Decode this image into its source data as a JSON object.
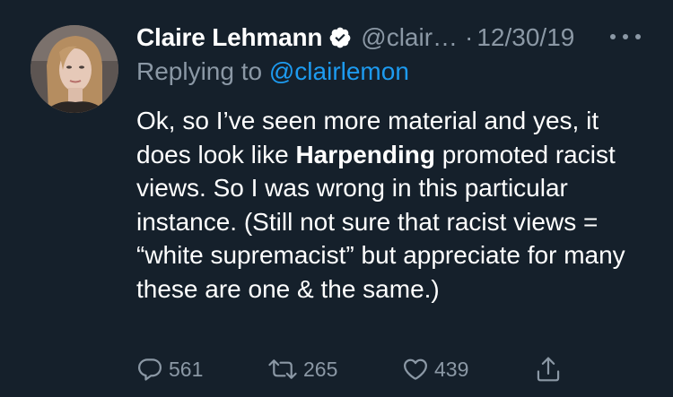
{
  "tweet": {
    "author": {
      "display_name": "Claire Lehmann",
      "handle": "@clair…",
      "verified_icon": "verified-badge-icon"
    },
    "separator": "·",
    "date": "12/30/19",
    "more_icon": "more-dots-icon",
    "replying_to": {
      "prefix": "Replying to ",
      "handle": "@clairlemon"
    },
    "text": {
      "part1": "Ok, so I’ve seen more material and yes, it does look like ",
      "bold": "Harpending",
      "part2": " promoted racist views. So I was wrong in this particular instance. (Still not sure that racist views = “white supremacist” but appreciate for many these are one & the same.)"
    },
    "actions": {
      "reply_count": "561",
      "retweet_count": "265",
      "like_count": "439",
      "icons": [
        "reply-icon",
        "retweet-icon",
        "like-icon",
        "share-icon"
      ]
    }
  },
  "colors": {
    "background": "#15202b",
    "text": "#ffffff",
    "muted": "#8b98a5",
    "link": "#1d9bf0"
  }
}
